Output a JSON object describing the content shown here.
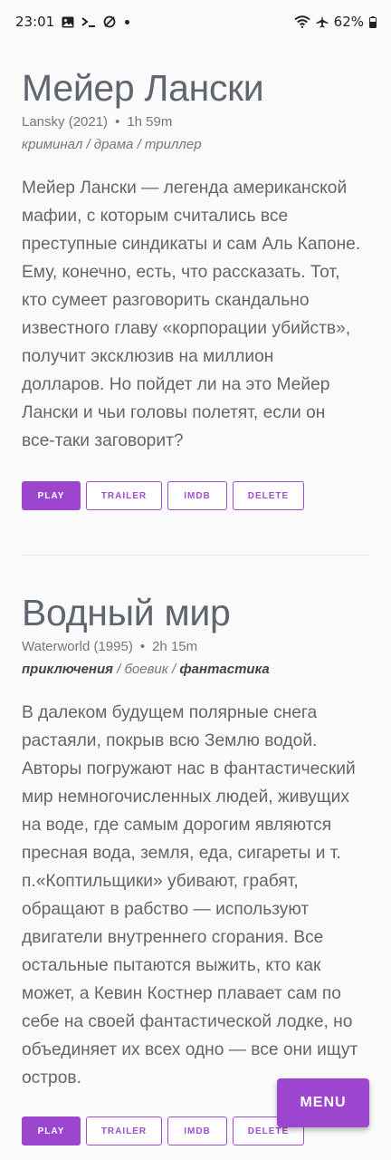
{
  "status_bar": {
    "time": "23:01",
    "battery": "62%",
    "icons": [
      "image-icon",
      "terminal-icon",
      "sync-off-icon",
      "dot-icon",
      "wifi-icon",
      "airplane-icon",
      "battery-icon"
    ]
  },
  "movies": [
    {
      "title": "Мейер Лански",
      "original": "Lansky (2021)",
      "duration": "1h 59m",
      "genres": [
        {
          "name": "криминал",
          "bold": false
        },
        {
          "name": "драма",
          "bold": false
        },
        {
          "name": "триллер",
          "bold": false
        }
      ],
      "description": "Мейер Лански — легенда американской\nмафии, с которым считались все\nпреступные синдикаты и сам Аль Капоне.\nЕму, конечно, есть, что рассказать. Тот,\nкто сумеет разговорить скандально\nизвестного главу «корпорации убийств»,\nполучит эксклюзив на миллион\nдолларов. Но пойдет ли на это Мейер\nЛански и чьи головы полетят, если он\nвсе-таки заговорит?",
      "buttons": {
        "play": "PLAY",
        "trailer": "TRAILER",
        "imdb": "IMDB",
        "delete": "DELETE"
      }
    },
    {
      "title": "Водный мир",
      "original": "Waterworld (1995)",
      "duration": "2h 15m",
      "genres": [
        {
          "name": "приключения",
          "bold": true
        },
        {
          "name": "боевик",
          "bold": false
        },
        {
          "name": "фантастика",
          "bold": true
        }
      ],
      "description": "В далеком будущем полярные снега\nрастаяли, покрыв всю Землю водой.\nАвторы погружают нас в фантастический\nмир немногочисленных людей, живущих\nна воде, где самым дорогим являются\nпресная вода, земля, еда, сигареты и т.\nп.«Коптильщики» убивают, грабят,\nобращают в рабство — используют\nдвигатели внутреннего сгорания. Все\nостальные пытаются выжить, кто как\nможет, а Кевин Костнер плавает сам по\nсебе на своей фантастической лодке, но\nобъединяет их всех одно — все они ищут\nостров.",
      "buttons": {
        "play": "PLAY",
        "trailer": "TRAILER",
        "imdb": "IMDB",
        "delete": "DELETE"
      }
    }
  ],
  "menu_button": "MENU",
  "colors": {
    "accent": "#9c45cf",
    "title": "#5f6670",
    "background": "#fafafa"
  }
}
